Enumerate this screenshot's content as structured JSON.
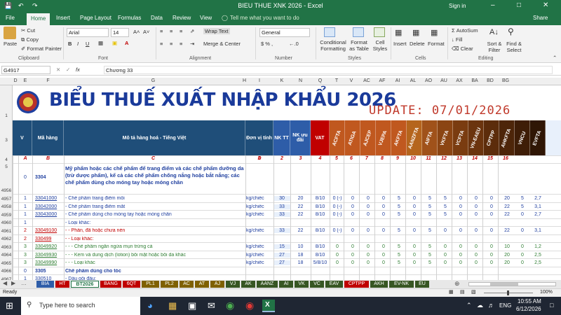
{
  "window": {
    "title": "BIEU THUE XNK 2026 - Excel",
    "sign_in": "Sign in"
  },
  "menu": {
    "file": "File",
    "home": "Home",
    "insert": "Insert",
    "page_layout": "Page Layout",
    "formulas": "Formulas",
    "data": "Data",
    "review": "Review",
    "view": "View",
    "tell_me": "Tell me what you want to do",
    "share": "Share"
  },
  "ribbon": {
    "paste": "Paste",
    "cut": "Cut",
    "copy": "Copy",
    "format_painter": "Format Painter",
    "clipboard": "Clipboard",
    "font_name": "Arial",
    "font_size": "14",
    "font": "Font",
    "wrap_text": "Wrap Text",
    "merge_center": "Merge & Center",
    "alignment": "Alignment",
    "number_format": "General",
    "number": "Number",
    "conditional_formatting": "Conditional Formatting",
    "format_as_table": "Format as Table",
    "cell_styles": "Cell Styles",
    "styles": "Styles",
    "insert": "Insert",
    "delete": "Delete",
    "format": "Format",
    "cells": "Cells",
    "autosum": "AutoSum",
    "fill": "Fill",
    "clear": "Clear",
    "sort_filter": "Sort & Filter",
    "find_select": "Find & Select",
    "editing": "Editing",
    "bold": "B",
    "italic": "I",
    "underline": "U",
    "fx": "fx"
  },
  "formula_bar": {
    "name_box": "G4917",
    "formula": "Chương 33"
  },
  "columns": [
    "D",
    "E",
    "F",
    "G",
    "H",
    "I",
    "K",
    "N",
    "Q",
    "T",
    "V",
    "AC",
    "AF",
    "AI",
    "AL",
    "AO",
    "AU",
    "AX",
    "BA",
    "BD",
    "BG"
  ],
  "sheet": {
    "banner_title": "BIỂU THUẾ XUẤT NHẬP KHẨU 2026",
    "update": "UPDATE: 07/01/2026",
    "headers": {
      "v": "V",
      "ma_hang": "Mã hàng",
      "mo_ta": "Mô tả hàng hoá - Tiếng Việt",
      "don_vi": "Đơn vị tính",
      "nktt": "NK TT",
      "nk_uu_dai": "NK ưu đãi",
      "vat": "VAT",
      "fta": [
        "ACFTA",
        "ATIGA",
        "AJCEP",
        "VJEPA",
        "AKFTA",
        "AANZFTA",
        "AIFTA",
        "VKFTA",
        "VCFTA",
        "VN-EAEU",
        "CPTPP",
        "AHKFTA",
        "VNCU",
        "EVFTA"
      ]
    },
    "letters": [
      "A",
      "B",
      "C",
      "D",
      "1",
      "2",
      "3",
      "4",
      "5",
      "6",
      "7",
      "8",
      "9",
      "10",
      "11",
      "12",
      "13",
      "14",
      "15",
      "16",
      "17"
    ],
    "desc_3304": "Mỹ phẩm hoặc các chế phẩm để trang điểm và các chế phẩm dưỡng da (trừ dược phẩm), kể cả các chế phẩm chống nắng hoặc bắt nắng; các chế phẩm dùng cho móng tay hoặc móng chân",
    "rows": [
      {
        "n": "4956",
        "v": "0",
        "code": "3304"
      },
      {
        "n": "4957",
        "v": "1",
        "code": "33041000",
        "desc": "- Chế phẩm trang điểm môi",
        "unit": "kg/chiếc",
        "nktt": "30",
        "nkud": "20",
        "vat": "8/10",
        "f": [
          "0 (-)",
          "0",
          "0",
          "0",
          "5",
          "0",
          "5",
          "5",
          "0",
          "0",
          "0",
          "20",
          "5",
          "2,7"
        ]
      },
      {
        "n": "4958",
        "v": "1",
        "code": "33042000",
        "desc": "- Chế phẩm trang điểm mắt",
        "unit": "kg/chiếc",
        "nktt": "33",
        "nkud": "22",
        "vat": "8/10",
        "f": [
          "0 (-)",
          "0",
          "0",
          "0",
          "5",
          "0",
          "5",
          "5",
          "0",
          "0",
          "0",
          "22",
          "5",
          "3,1"
        ]
      },
      {
        "n": "4959",
        "v": "1",
        "code": "33043000",
        "desc": "- Chế phẩm dùng cho móng tay hoặc móng chân",
        "unit": "kg/chiếc",
        "nktt": "33",
        "nkud": "22",
        "vat": "8/10",
        "f": [
          "0 (-)",
          "0",
          "0",
          "0",
          "5",
          "0",
          "5",
          "5",
          "0",
          "0",
          "0",
          "22",
          "0",
          "2,7"
        ]
      },
      {
        "n": "4960",
        "v": "1",
        "code": "",
        "desc": "- Loại khác:"
      },
      {
        "n": "4961",
        "v": "2",
        "code": "33049100",
        "desc": "- - Phấn, đã hoặc chưa nén",
        "unit": "kg/chiếc",
        "nktt": "33",
        "nkud": "22",
        "vat": "8/10",
        "f": [
          "0 (-)",
          "0",
          "0",
          "0",
          "5",
          "0",
          "5",
          "0",
          "0",
          "0",
          "0",
          "22",
          "0",
          "3,1"
        ],
        "red": true
      },
      {
        "n": "4962",
        "v": "2",
        "code": "330499",
        "desc": "- - Loại khác:",
        "red": true
      },
      {
        "n": "4963",
        "v": "3",
        "code": "33049920",
        "desc": "- - - Chế phẩm ngăn ngừa mụn trứng cá",
        "unit": "kg/chiếc",
        "nktt": "15",
        "nkud": "10",
        "vat": "8/10",
        "f": [
          "0",
          "0",
          "0",
          "0",
          "5",
          "0",
          "5",
          "0",
          "0",
          "0",
          "0",
          "10",
          "0",
          "1,2"
        ],
        "green": true
      },
      {
        "n": "4964",
        "v": "3",
        "code": "33049930",
        "desc": "- - - Kem và dung dịch (lotion) bôi mặt hoặc bôi da khác",
        "unit": "kg/chiếc",
        "nktt": "27",
        "nkud": "18",
        "vat": "8/10",
        "f": [
          "0",
          "0",
          "0",
          "0",
          "5",
          "0",
          "5",
          "0",
          "0",
          "0",
          "0",
          "20",
          "0",
          "2,5"
        ],
        "green": true
      },
      {
        "n": "4965",
        "v": "3",
        "code": "33049990",
        "desc": "- - - Loại khác",
        "unit": "kg/chiếc",
        "nktt": "27",
        "nkud": "18",
        "vat": "5/8/10",
        "f": [
          "0",
          "0",
          "0",
          "0",
          "5",
          "0",
          "5",
          "0",
          "0",
          "0",
          "0",
          "20",
          "0",
          "2,5"
        ],
        "green": true
      },
      {
        "n": "4966",
        "v": "0",
        "code": "3305",
        "desc": "Chế phẩm dùng cho tóc",
        "bold": true
      },
      {
        "n": "4967",
        "v": "1",
        "code": "330510",
        "desc": "- Dầu gội đầu:"
      }
    ]
  },
  "sheet_tabs": [
    {
      "label": "BIA",
      "color": "#2e5da8"
    },
    {
      "label": "HT",
      "color": "#c00000"
    },
    {
      "label": "BT2026",
      "color": "#ffffff"
    },
    {
      "label": "BANG",
      "color": "#c00000"
    },
    {
      "label": "6QT",
      "color": "#c00000"
    },
    {
      "label": "PL1",
      "color": "#7f6000"
    },
    {
      "label": "PL2",
      "color": "#7f6000"
    },
    {
      "label": "AC",
      "color": "#7f6000"
    },
    {
      "label": "AT",
      "color": "#7f6000"
    },
    {
      "label": "AJ",
      "color": "#7f6000"
    },
    {
      "label": "VJ",
      "color": "#375623"
    },
    {
      "label": "AK",
      "color": "#375623"
    },
    {
      "label": "AANZ",
      "color": "#375623"
    },
    {
      "label": "AI",
      "color": "#375623"
    },
    {
      "label": "VK",
      "color": "#375623"
    },
    {
      "label": "VC",
      "color": "#375623"
    },
    {
      "label": "EAV",
      "color": "#375623"
    },
    {
      "label": "CPTPP",
      "color": "#c00000"
    },
    {
      "label": "AKH",
      "color": "#375623"
    },
    {
      "label": "EV-NK",
      "color": "#375623"
    },
    {
      "label": "EU",
      "color": "#375623"
    }
  ],
  "status": {
    "ready": "Ready",
    "zoom": "100%"
  },
  "taskbar": {
    "search": "Type here to search",
    "lang": "ENG",
    "time": "10:55 AM",
    "date": "6/12/2026"
  },
  "colors": {
    "excel_green": "#217346",
    "header_blue": "#1f4e79",
    "banner_blue": "#1a3a9a",
    "update_red": "#c0392b",
    "code_blue": "#1f3f9f"
  }
}
